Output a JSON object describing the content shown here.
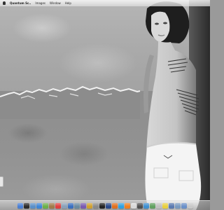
{
  "menubar": {
    "apple_icon": "apple-icon",
    "items": [
      {
        "label": "Quantum Sc..",
        "bold": true
      },
      {
        "label": "Images"
      },
      {
        "label": "Window"
      },
      {
        "label": "Help"
      }
    ]
  },
  "tattoo_text": {
    "shoulder": "We will all",
    "side": "All the"
  },
  "dock": {
    "icons": [
      {
        "name": "finder-icon",
        "color": "#4a7fd4"
      },
      {
        "name": "dashboard-icon",
        "color": "#2b2b2b"
      },
      {
        "name": "mail-icon",
        "color": "#5a8fc8"
      },
      {
        "name": "safari-icon",
        "color": "#3d86d8"
      },
      {
        "name": "ichat-icon",
        "color": "#6bb04a"
      },
      {
        "name": "address-book-icon",
        "color": "#a07a4a"
      },
      {
        "name": "ical-icon",
        "color": "#e04040"
      },
      {
        "name": "preview-icon",
        "color": "#8aa0b8"
      },
      {
        "name": "itunes-icon",
        "color": "#3a6fc0"
      },
      {
        "name": "iphoto-icon",
        "color": "#6a8aa0"
      },
      {
        "name": "imovie-icon",
        "color": "#7a5ab0"
      },
      {
        "name": "garageband-icon",
        "color": "#d0a030"
      },
      {
        "name": "system-preferences-icon",
        "color": "#8a8a8a"
      },
      {
        "name": "terminal-icon",
        "color": "#222222"
      },
      {
        "name": "photoshop-icon",
        "color": "#2a4a8a"
      },
      {
        "name": "firefox-icon",
        "color": "#e07020"
      },
      {
        "name": "skype-icon",
        "color": "#30a0e0"
      },
      {
        "name": "vlc-icon",
        "color": "#f08020"
      },
      {
        "name": "textedit-icon",
        "color": "#d8d8d8"
      },
      {
        "name": "calculator-icon",
        "color": "#505050"
      },
      {
        "name": "app-store-icon",
        "color": "#4090d0"
      },
      {
        "name": "itunes-alt-icon",
        "color": "#60a060"
      },
      {
        "name": "utility-icon",
        "color": "#c0c0c0"
      },
      {
        "name": "stickies-icon",
        "color": "#e8d040"
      },
      {
        "name": "downloads-icon",
        "color": "#5a7ab0"
      },
      {
        "name": "documents-icon",
        "color": "#7a9ac0"
      },
      {
        "name": "folder-icon",
        "color": "#6a90c8"
      },
      {
        "name": "trash-icon",
        "color": "#c8c8c8"
      }
    ]
  }
}
